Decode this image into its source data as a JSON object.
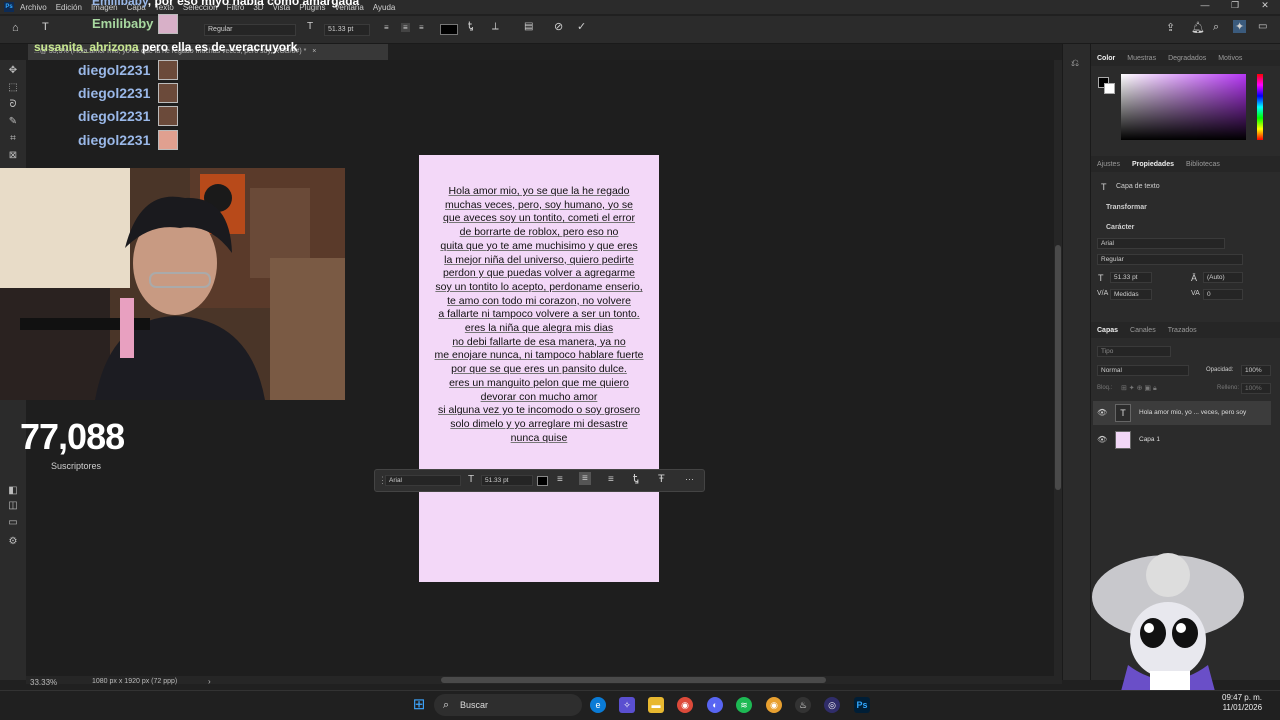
{
  "menu": {
    "items": [
      "Archivo",
      "Edición",
      "Imagen",
      "Capa",
      "Texto",
      "Selección",
      "Filtro",
      "3D",
      "Vista",
      "Plugins",
      "Ventana",
      "Ayuda"
    ],
    "ps_badge": "Ps",
    "window_controls": [
      "—",
      "❐",
      "✕"
    ]
  },
  "options_bar": {
    "font_style": "Regular",
    "font_size": "51.33 pt",
    "text_color": "#000000",
    "commit_icon": "check-icon",
    "cancel_icon": "cancel-icon"
  },
  "doc_tab": {
    "title": "...@ 33,3% (Hola amor mio, yo se que la he regado muchas veces, pero soy, RGB/8#) *",
    "close": "×"
  },
  "chat": {
    "messages": [
      {
        "user": "Emilibaby",
        "text": "por eso miyo habla como amargada"
      },
      {
        "user": "Emilibaby",
        "text": ""
      },
      {
        "user": "susanita_ahrizona",
        "text": "pero ella es de veracruyork"
      },
      {
        "user": "diegol2231",
        "text": ""
      },
      {
        "user": "diegol2231",
        "text": ""
      },
      {
        "user": "diegol2231",
        "text": ""
      },
      {
        "user": "diegol2231",
        "text": ""
      }
    ]
  },
  "subscribers": {
    "count": "77,088",
    "label": "Suscriptores"
  },
  "document": {
    "background": "#f3d8f8",
    "lines": [
      "Hola amor mio, yo se que la he regado",
      "muchas veces, pero, soy humano, yo se",
      "que aveces soy un tontito, cometi el error",
      "de borrarte de roblox, pero eso no",
      "quita que yo te ame muchisimo y que eres",
      "la mejor niña del universo, quiero pedirte",
      "perdon y que puedas volver a agregarme",
      "soy un tontito lo acepto, perdoname enserio,",
      "te amo con todo mi corazon, no volvere",
      "a fallarte ni tampoco volvere a ser un tonto.",
      "eres la niña que alegra mis dias",
      "no debi fallarte de esa manera, ya no",
      "me enojare nunca, ni tampoco hablare fuerte",
      "por que se que eres un pansito dulce.",
      "eres un manguito pelon que me quiero",
      "devorar con mucho amor",
      "si alguna vez yo te incomodo o soy grosero",
      "solo dimelo y yo arreglare mi desastre",
      "nunca quise"
    ]
  },
  "context_bar": {
    "font": "Arial",
    "size": "51.33 pt",
    "more": "···"
  },
  "status": {
    "zoom": "33.33%",
    "dimensions": "1080 px x 1920 px (72 ppp)"
  },
  "panels": {
    "color_tabs": [
      "Color",
      "Muestras",
      "Degradados",
      "Motivos"
    ],
    "props_tabs": [
      "Ajustes",
      "Propiedades",
      "Bibliotecas"
    ],
    "props_kind": "Capa de texto",
    "transform_label": "Transformar",
    "character_label": "Carácter",
    "font": "Arial",
    "style": "Regular",
    "size": "51.33 pt",
    "leading": "(Auto)",
    "kerning": "Medidas",
    "tracking": "0",
    "layers_tabs": [
      "Capas",
      "Canales",
      "Trazados"
    ],
    "layer_filter": "Tipo",
    "blend_mode": "Normal",
    "opacity_label": "Opacidad:",
    "opacity": "100%",
    "lock_label": "Bloq.:",
    "fill_label": "Relleno:",
    "fill": "100%",
    "layers": [
      {
        "name": "Hola amor mio, yo ... veces, pero  soy",
        "type": "text"
      },
      {
        "name": "Capa 1",
        "type": "fill"
      }
    ]
  },
  "taskbar": {
    "search_placeholder": "Buscar",
    "time": "09:47 p. m.",
    "date": "11/01/2026"
  }
}
